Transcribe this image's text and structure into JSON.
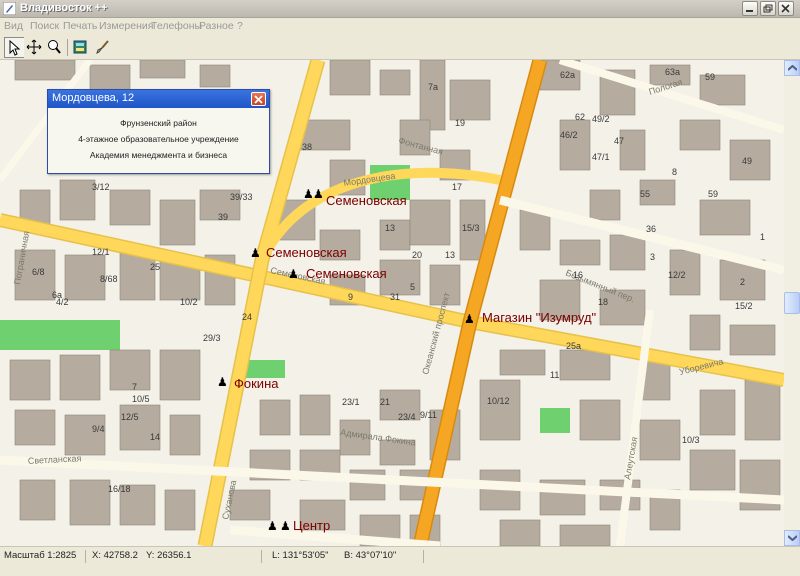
{
  "window": {
    "title": "Владивосток ++",
    "icon": "pen-icon"
  },
  "menu": [
    "Вид",
    "Поиск",
    "Печать",
    "Измерения",
    "Телефоны",
    "Разное",
    "?"
  ],
  "toolbar": {
    "tools": [
      "arrow-select-icon",
      "pan-move-icon",
      "zoom-magnifier-icon",
      "map-layer-icon",
      "brush-icon"
    ]
  },
  "popup": {
    "title": "Мордовцева, 12",
    "lines": [
      "Фрунзенский район",
      "4-этажное образовательное учреждение",
      "Академия менеджмента и бизнеса"
    ]
  },
  "map": {
    "stops": [
      "Семеновская",
      "Семеновская",
      "Семеновская",
      "Магазин \"Изумруд\"",
      "Фокина",
      "Центр"
    ],
    "streets": [
      "Фонтанная",
      "Мордовцева",
      "Семеновская",
      "Океанский проспект",
      "Уборевича",
      "Адмирала Фокина",
      "Светланская",
      "Пограничная",
      "Безымянный пер.",
      "Пологая",
      "Алеутская",
      "Суханова"
    ],
    "building_numbers": [
      "62а",
      "62",
      "63а",
      "59",
      "7а",
      "19",
      "49/2",
      "46/2",
      "47/1",
      "47",
      "38",
      "49",
      "8",
      "39/33",
      "3/12",
      "12/1",
      "13",
      "15/3",
      "36",
      "55",
      "59",
      "6/8",
      "8/68",
      "25",
      "10/2",
      "12/2",
      "16",
      "18",
      "15/2",
      "25а",
      "29/3",
      "10/12",
      "11",
      "23/1",
      "21",
      "23/4",
      "9/11",
      "12/5",
      "10/5",
      "9/4",
      "14",
      "16/18",
      "10/3",
      "13",
      "20",
      "39",
      "4/2",
      "6а",
      "31",
      "7",
      "1",
      "2",
      "3",
      "5",
      "9",
      "17",
      "24"
    ]
  },
  "status": {
    "scale": "Масштаб 1:2825",
    "x": "X: 42758.2",
    "y": "Y: 26356.1",
    "lon": "L: 131°53'05\"",
    "lat": "B: 43°07'10\""
  },
  "colors": {
    "road_major": "#ffd75a",
    "road_orange": "#f5a623",
    "building": "#b5ac9f",
    "park": "#6fd06f",
    "map_bg": "#f3f1e8",
    "stop_text": "#7a0000"
  }
}
